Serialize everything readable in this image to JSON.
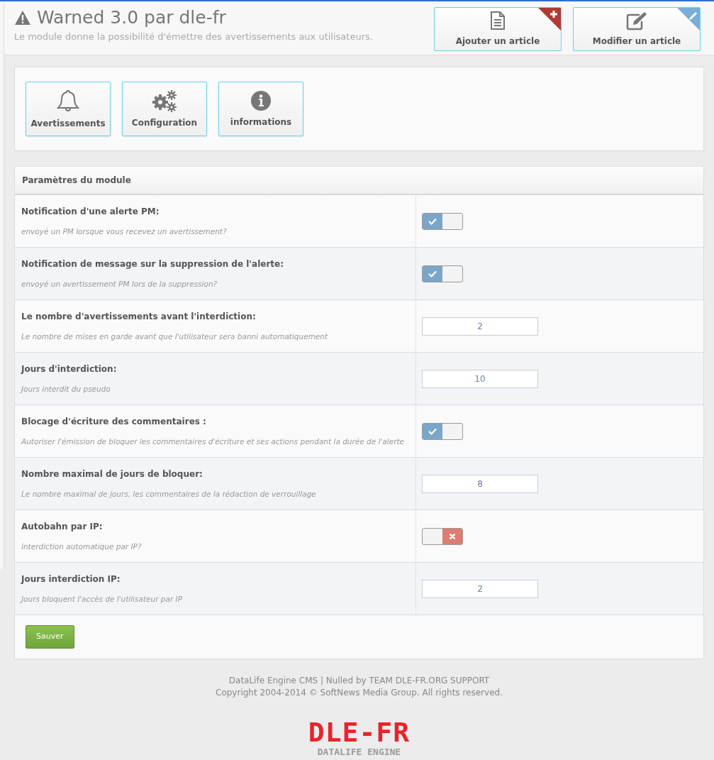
{
  "header": {
    "title": "Warned 3.0 par dle-fr",
    "subtitle": "Le module donne la possibilité d'émettre des avertissements aux utilisateurs.",
    "actions": [
      {
        "label": "Ajouter un article",
        "kind": "add"
      },
      {
        "label": "Modifier un article",
        "kind": "edit"
      }
    ]
  },
  "nav_buttons": [
    {
      "label": "Avertissements",
      "kind": "bell"
    },
    {
      "label": "Configuration",
      "kind": "gears"
    },
    {
      "label": "informations",
      "kind": "info"
    }
  ],
  "settings": {
    "title": "Paramètres du module",
    "rows": [
      {
        "label": "Notification d'une alerte PM:",
        "hint": "envoyé un PM lorsque vous recevez un avertissement?",
        "kind": "toggle",
        "on": true
      },
      {
        "label": "Notification de message sur la suppression de l'alerte:",
        "hint": "envoyé un avertissement PM lors de la suppression?",
        "kind": "toggle",
        "on": true
      },
      {
        "label": "Le nombre d'avertissements avant l'interdiction:",
        "hint": "Le nombre de mises en garde avant que l'utilisateur sera banni automatiquement",
        "kind": "number",
        "value": "2"
      },
      {
        "label": "Jours d'interdiction:",
        "hint": "Jours interdit du pseudo",
        "kind": "number",
        "value": "10"
      },
      {
        "label": "Blocage d'écriture des commentaires :",
        "hint": "Autoriser l'émission de bloquer les commentaires d'écriture et ses actions pendant la durée de l'alerte",
        "kind": "toggle",
        "on": true
      },
      {
        "label": "Nombre maximal de jours de bloquer:",
        "hint": "Le nombre maximal de jours, les commentaires de la rédaction de verrouillage",
        "kind": "number",
        "value": "8"
      },
      {
        "label": "Autobahn par IP:",
        "hint": "interdiction automatique par IP?",
        "kind": "toggle",
        "on": false
      },
      {
        "label": "Jours interdiction IP:",
        "hint": "Jours bloquent l'accès de l'utilisateur par IP",
        "kind": "number",
        "value": "2"
      }
    ],
    "save_button": "Sauver"
  },
  "footer": {
    "lines": [
      "DataLife Engine CMS | Nulled by TEAM DLE-FR.ORG SUPPORT",
      "Copyright 2004-2014 © SoftNews Media Group. All rights reserved."
    ],
    "logo": {
      "name": "DLE-FR",
      "tagline": "DATALIFE ENGINE"
    }
  }
}
